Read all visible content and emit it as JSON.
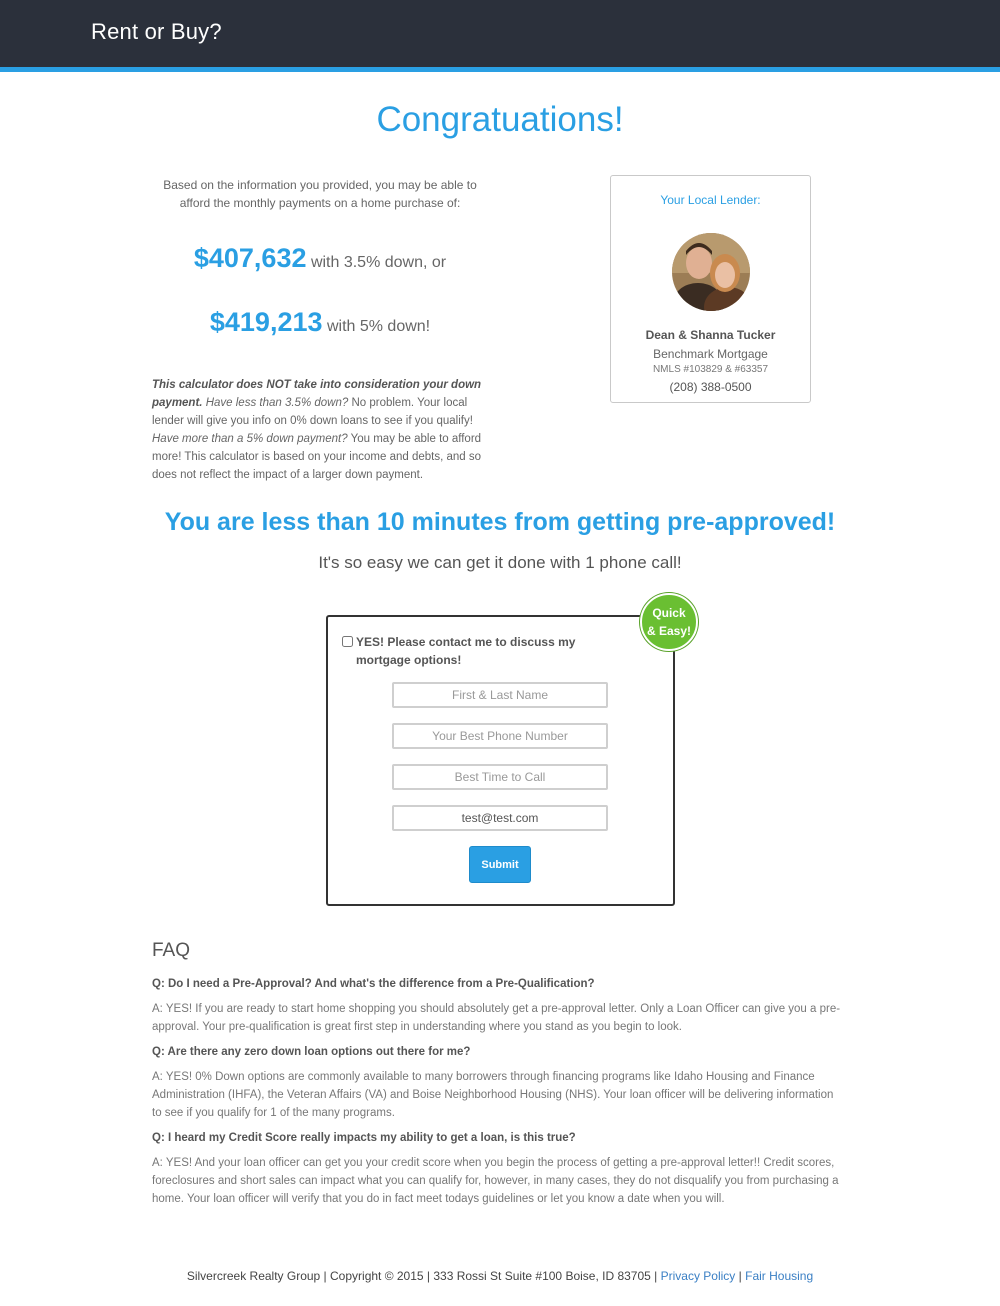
{
  "header": {
    "brand": "Rent or Buy?"
  },
  "result": {
    "headline": "Congratuations!",
    "intro": "Based on the information you provided, you may be able to afford the monthly payments on a home purchase of:",
    "amount1": "$407,632",
    "amount1_suffix": "with 3.5% down, or",
    "amount2": "$419,213",
    "amount2_suffix": "with 5% down!",
    "disclaimer_bold": "This calculator does NOT take into consideration your down payment.",
    "disclaimer_q1": "Have less than 3.5% down?",
    "disclaimer_t1": "No problem. Your local lender will give you info on 0% down loans to see if you qualify!",
    "disclaimer_q2": "Have more than a 5% down payment?",
    "disclaimer_t2": "You may be able to afford more! This calculator is based on your income and debts, and so does not reflect the impact of a larger down payment."
  },
  "lender": {
    "title": "Your Local Lender:",
    "name": "Dean & Shanna Tucker",
    "company": "Benchmark Mortgage",
    "nmls": "NMLS #103829 & #63357",
    "phone": "(208) 388-0500"
  },
  "cta": {
    "headline": "You are less than 10 minutes from getting pre-approved!",
    "subheadline": "It's so easy we can get it done with 1 phone call!"
  },
  "form": {
    "badge_line1": "Quick",
    "badge_line2": "& Easy!",
    "consent_label": "YES! Please contact me to discuss my mortgage options!",
    "name_placeholder": "First & Last Name",
    "phone_placeholder": "Your Best Phone Number",
    "time_placeholder": "Best Time to Call",
    "email_value": "test@test.com",
    "submit_label": "Submit"
  },
  "faq": {
    "title": "FAQ",
    "items": [
      {
        "q": "Q: Do I need a Pre-Approval? And what's the difference from a Pre-Qualification?",
        "a": "A: YES! If you are ready to start home shopping you should absolutely get a pre-approval letter. Only a Loan Officer can give you a pre-approval. Your pre-qualification is great first step in understanding where you stand as you begin to look."
      },
      {
        "q": "Q: Are there any zero down loan options out there for me?",
        "a": "A: YES! 0% Down options are commonly available to many borrowers through financing programs like Idaho Housing and Finance Administration (IHFA), the Veteran Affairs (VA) and Boise Neighborhood Housing (NHS). Your loan officer will be delivering information to see if you qualify for 1 of the many programs."
      },
      {
        "q": "Q: I heard my Credit Score really impacts my ability to get a loan, is this true?",
        "a": "A: YES! And your loan officer can get you your credit score when you begin the process of getting a pre-approval letter!! Credit scores, foreclosures and short sales can impact what you can qualify for, however, in many cases, they do not disqualify you from purchasing a home. Your loan officer will verify that you do in fact meet todays guidelines or let you know a date when you will."
      }
    ]
  },
  "footer": {
    "text": "Silvercreek Realty Group | Copyright © 2015 | 333 Rossi St Suite #100 Boise, ID 83705 |",
    "sep": "|",
    "privacy_link": "Privacy Policy",
    "fair_housing_link": "Fair Housing"
  },
  "colors": {
    "header_bg": "#2b303b",
    "accent": "#2a9fe3",
    "badge": "#6abf32"
  }
}
